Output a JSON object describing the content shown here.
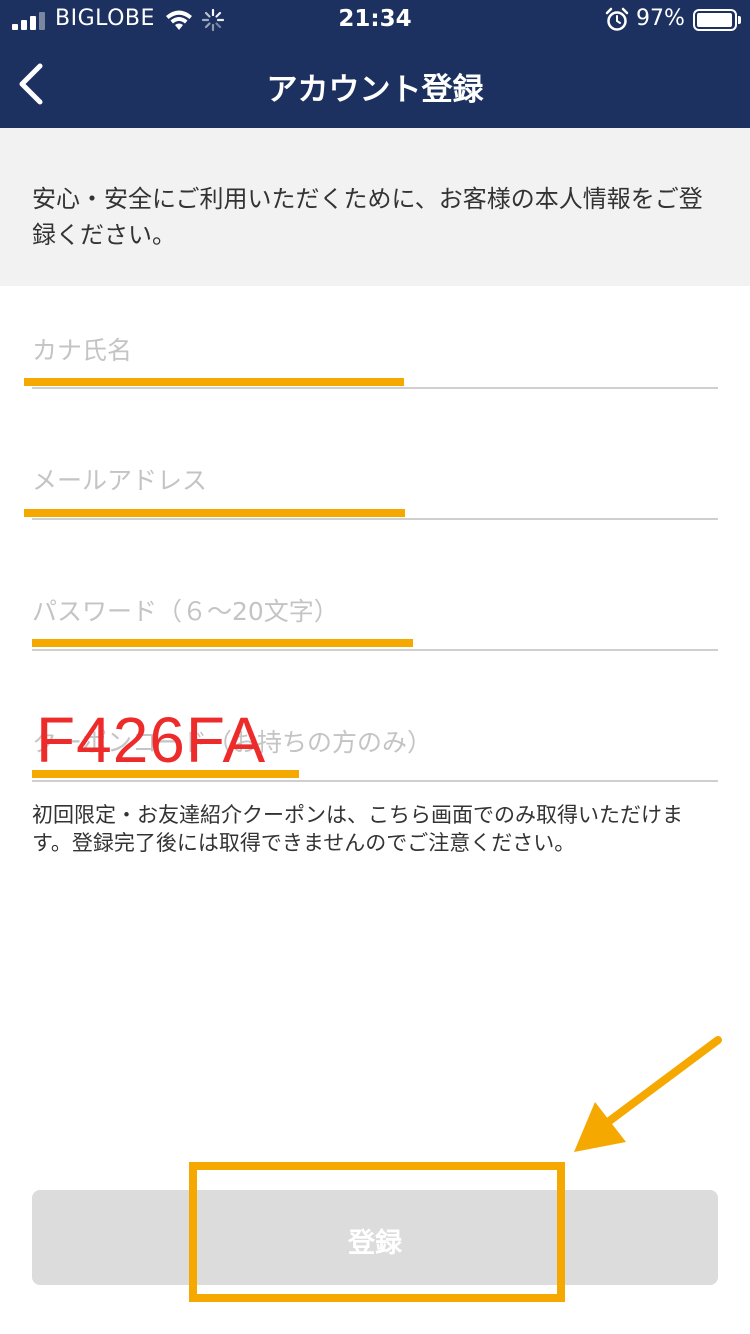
{
  "status_bar": {
    "carrier": "BIGLOBE",
    "time": "21:34",
    "battery_percent": "97%",
    "battery_level": 0.97,
    "icons": [
      "signal-icon",
      "wifi-icon",
      "loading-spinner-icon",
      "alarm-icon",
      "battery-icon"
    ]
  },
  "nav": {
    "title": "アカウント登録",
    "back_icon": "chevron-left-icon"
  },
  "notice": {
    "text": "安心・安全にご利用いただくために、お客様の本人情報をご登録ください。"
  },
  "form": {
    "kana_name_placeholder": "カナ氏名",
    "email_placeholder": "メールアドレス",
    "password_placeholder": "パスワード（６〜20文字）",
    "coupon_placeholder": "クーポンコード（お持ちの方のみ）",
    "coupon_handwritten_value": "F426FA",
    "coupon_note": "初回限定・お友達紹介クーポンは、こちら画面でのみ取得いただけます。登録完了後には取得できませんのでご注意ください。"
  },
  "submit": {
    "label": "登録"
  },
  "colors": {
    "nav_background": "#1c3160",
    "notice_background": "#f2f2f2",
    "highlight": "#f5a800",
    "handwritten": "#ee2b2b",
    "button_disabled": "#dcdcdc"
  }
}
